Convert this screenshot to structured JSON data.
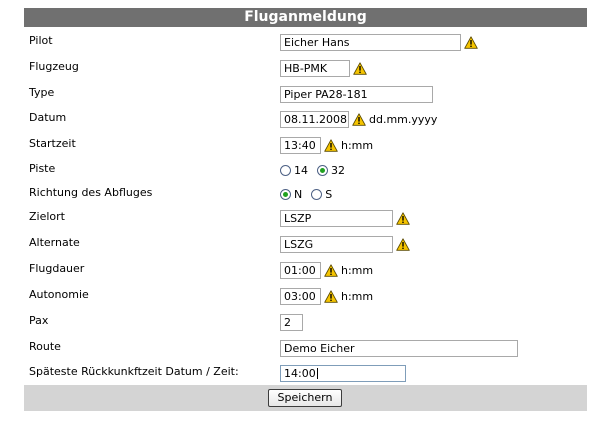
{
  "form": {
    "title": "Fluganmeldung",
    "pilot": {
      "label": "Pilot",
      "value": "Eicher Hans"
    },
    "flugzeug": {
      "label": "Flugzeug",
      "value": "HB-PMK"
    },
    "type": {
      "label": "Type",
      "value": "Piper PA28-181"
    },
    "datum": {
      "label": "Datum",
      "value": "08.11.2008",
      "hint": "dd.mm.yyyy"
    },
    "startzeit": {
      "label": "Startzeit",
      "value": "13:40",
      "hint": "h:mm"
    },
    "piste": {
      "label": "Piste",
      "options": [
        "14",
        "32"
      ],
      "selected": "32"
    },
    "richtung": {
      "label": "Richtung des Abfluges",
      "options": [
        "N",
        "S"
      ],
      "selected": "N"
    },
    "zielort": {
      "label": "Zielort",
      "value": "LSZP"
    },
    "alternate": {
      "label": "Alternate",
      "value": "LSZG"
    },
    "flugdauer": {
      "label": "Flugdauer",
      "value": "01:00",
      "hint": "h:mm"
    },
    "autonomie": {
      "label": "Autonomie",
      "value": "03:00",
      "hint": "h:mm"
    },
    "pax": {
      "label": "Pax",
      "value": "2"
    },
    "route": {
      "label": "Route",
      "value": "Demo Eicher"
    },
    "rueckkunft": {
      "label": "Späteste Rückkunkftzeit Datum / Zeit:",
      "value": "14:00"
    },
    "save_label": "Speichern"
  },
  "colors": {
    "header_bg": "#707070",
    "footer_bg": "#d4d4d4",
    "warning": "#f5c400",
    "radio_checked": "#21a121"
  },
  "icons": {
    "warning": "warning-triangle-icon"
  }
}
